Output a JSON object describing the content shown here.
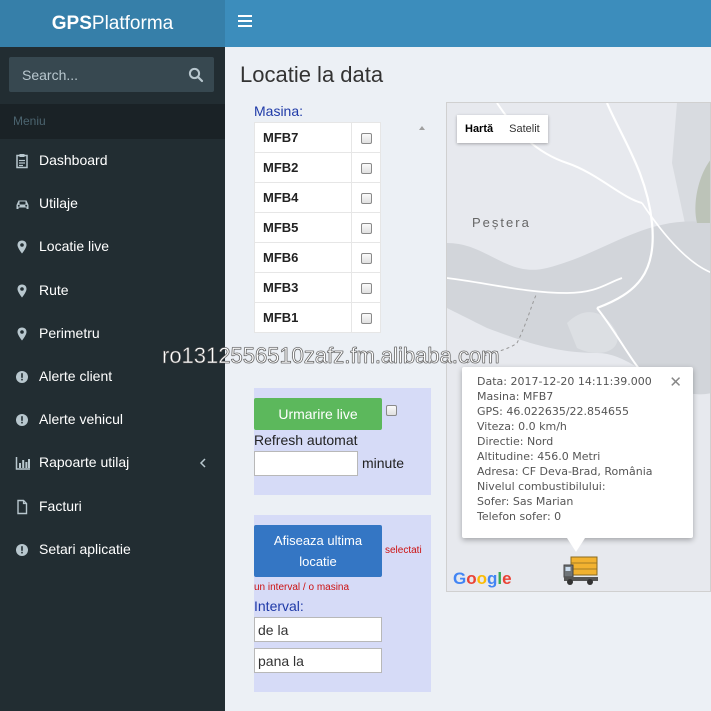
{
  "app": {
    "logo_bold": "GPS",
    "logo_rest": "Platforma"
  },
  "search": {
    "placeholder": "Search...",
    "icon": "search-icon"
  },
  "sidebar": {
    "header": "Meniu",
    "items": [
      {
        "label": "Dashboard",
        "icon": "clipboard-icon"
      },
      {
        "label": "Utilaje",
        "icon": "car-icon"
      },
      {
        "label": "Locatie live",
        "icon": "map-marker-icon"
      },
      {
        "label": "Rute",
        "icon": "map-marker-icon"
      },
      {
        "label": "Perimetru",
        "icon": "map-marker-icon"
      },
      {
        "label": "Alerte client",
        "icon": "alert-circle-icon"
      },
      {
        "label": "Alerte vehicul",
        "icon": "alert-circle-icon"
      },
      {
        "label": "Rapoarte utilaj",
        "icon": "bar-chart-icon"
      },
      {
        "label": "Facturi",
        "icon": "document-icon"
      },
      {
        "label": "Setari aplicatie",
        "icon": "alert-circle-icon"
      }
    ]
  },
  "page": {
    "title": "Locatie la data"
  },
  "vehicles": {
    "label": "Masina:",
    "list": [
      {
        "name": "MFB7",
        "checked": false
      },
      {
        "name": "MFB2",
        "checked": false
      },
      {
        "name": "MFB4",
        "checked": false
      },
      {
        "name": "MFB5",
        "checked": false
      },
      {
        "name": "MFB6",
        "checked": false
      },
      {
        "name": "MFB3",
        "checked": false
      },
      {
        "name": "MFB1",
        "checked": false
      }
    ]
  },
  "live": {
    "button": "Urmarire live",
    "refresh_label": "Refresh automat",
    "minutes_value": "",
    "minutes_unit": "minute"
  },
  "last_location": {
    "button_line1": "Afiseaza ultima",
    "button_line2": "locatie",
    "hint_part1": "selectati",
    "hint_part2": "un interval / o masina",
    "interval_label": "Interval:",
    "from_value": "de la",
    "to_value": "pana la"
  },
  "map": {
    "type_map": "Hartă",
    "type_satellite": "Satelit",
    "place": "Peștera",
    "google": [
      "G",
      "o",
      "o",
      "g",
      "l",
      "e"
    ],
    "google_colors": [
      "#4285f4",
      "#ea4335",
      "#fbbc05",
      "#4285f4",
      "#34a853",
      "#ea4335"
    ],
    "info": {
      "lines": [
        "Data: 2017-12-20 14:11:39.000",
        "Masina: MFB7",
        "GPS: 46.022635/22.854655",
        "Viteza: 0.0 km/h",
        "Directie: Nord",
        "Altitudine: 456.0 Metri",
        "Adresa: CF Deva-Brad, România",
        "Nivelul combustibilului:",
        "Sofer: Sas Marian",
        "Telefon sofer: 0"
      ],
      "close": "✕"
    }
  },
  "watermark": "ro1312556510zafz.fm.alibaba.com",
  "colors": {
    "topbar": "#3c8dbc",
    "sidebar": "#222d32",
    "green_button": "#5cb85c",
    "blue_button": "#3476c4",
    "panel": "#d6dbf7"
  }
}
